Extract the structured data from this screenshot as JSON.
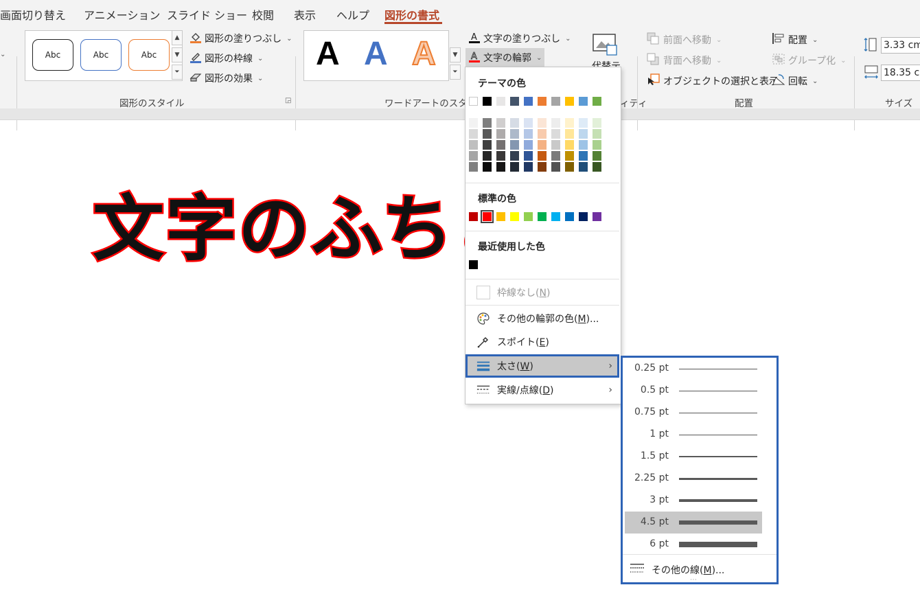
{
  "tabs": [
    {
      "label": "画面切り替え",
      "active": false
    },
    {
      "label": "アニメーション",
      "active": false
    },
    {
      "label": "スライド ショー",
      "active": false
    },
    {
      "label": "校閲",
      "active": false
    },
    {
      "label": "表示",
      "active": false
    },
    {
      "label": "ヘルプ",
      "active": false
    },
    {
      "label": "図形の書式",
      "active": true
    }
  ],
  "ribbon": {
    "shape_styles": {
      "samples": [
        "Abc",
        "Abc",
        "Abc"
      ],
      "sample_border_colors": [
        "#222222",
        "#4472c4",
        "#ed7d31"
      ],
      "fill_label": "図形の塗りつぶし",
      "outline_label": "図形の枠線",
      "effects_label": "図形の効果",
      "group_label": "図形のスタイル"
    },
    "wordart": {
      "samples": [
        "A",
        "A",
        "A"
      ],
      "text_fill_label": "文字の塗りつぶし",
      "text_outline_label": "文字の輪郭",
      "group_label": "ワードアートのスタイル"
    },
    "alt_text_label": "代替テ",
    "partial_label": "ィティ",
    "arrange": {
      "bring_forward_label": "前面へ移動",
      "send_backward_label": "背面へ移動",
      "selection_pane_label": "オブジェクトの選択と表示",
      "align_label": "配置",
      "group_label": "グループ化",
      "rotate_label": "回転",
      "section_label": "配置"
    },
    "size": {
      "height_value": "3.33 cm",
      "width_value": "18.35 cm",
      "group_label": "サイズ"
    }
  },
  "slide": {
    "text": "文字のふちど",
    "fill_color": "#111111",
    "outline_color": "#ff0000"
  },
  "outline_menu": {
    "theme_colors_heading": "テーマの色",
    "theme_colors": [
      "#ffffff",
      "#000000",
      "#e7e6e6",
      "#44546a",
      "#4472c4",
      "#ed7d31",
      "#a5a5a5",
      "#ffc000",
      "#5b9bd5",
      "#70ad47"
    ],
    "theme_shades": [
      [
        "#f2f2f2",
        "#d9d9d9",
        "#bfbfbf",
        "#a6a6a6",
        "#808080"
      ],
      [
        "#7f7f7f",
        "#595959",
        "#404040",
        "#262626",
        "#0d0d0d"
      ],
      [
        "#d0cece",
        "#aeabab",
        "#757171",
        "#3a3838",
        "#171616"
      ],
      [
        "#d6dce5",
        "#adb9ca",
        "#8497b0",
        "#333f50",
        "#222a35"
      ],
      [
        "#dae3f3",
        "#b4c7e7",
        "#8faadc",
        "#2f5597",
        "#203864"
      ],
      [
        "#fbe5d6",
        "#f8cbad",
        "#f4b183",
        "#c55a11",
        "#843c0c"
      ],
      [
        "#ededed",
        "#dbdbdb",
        "#c9c9c9",
        "#7b7b7b",
        "#525252"
      ],
      [
        "#fff2cc",
        "#ffe699",
        "#ffd966",
        "#bf9000",
        "#7f6000"
      ],
      [
        "#deebf7",
        "#bdd7ee",
        "#9dc3e6",
        "#2e75b6",
        "#1f4e79"
      ],
      [
        "#e2f0d9",
        "#c5e0b4",
        "#a9d18e",
        "#548235",
        "#385723"
      ]
    ],
    "standard_colors_heading": "標準の色",
    "standard_colors": [
      "#c00000",
      "#ff0000",
      "#ffc000",
      "#ffff00",
      "#92d050",
      "#00b050",
      "#00b0f0",
      "#0070c0",
      "#002060",
      "#7030a0"
    ],
    "recent_colors_heading": "最近使用した色",
    "recent_colors": [
      "#000000"
    ],
    "no_outline_label": "枠線なし(",
    "no_outline_key": "N",
    "more_colors_label": "その他の輪郭の色(",
    "more_colors_key": "M",
    "more_colors_suffix": ")...",
    "eyedropper_label": "スポイト(",
    "eyedropper_key": "E",
    "weight_label": "太さ(",
    "weight_key": "W",
    "dashes_label": "実線/点線(",
    "dashes_key": "D",
    "close_paren": ")"
  },
  "weight_submenu": {
    "options": [
      {
        "label": "0.25 pt",
        "weight": 0.25
      },
      {
        "label": "0.5 pt",
        "weight": 0.5
      },
      {
        "label": "0.75 pt",
        "weight": 0.75
      },
      {
        "label": "1 pt",
        "weight": 1
      },
      {
        "label": "1.5 pt",
        "weight": 1.5
      },
      {
        "label": "2.25 pt",
        "weight": 2.25
      },
      {
        "label": "3 pt",
        "weight": 3
      },
      {
        "label": "4.5 pt",
        "weight": 4.5
      },
      {
        "label": "6 pt",
        "weight": 6
      }
    ],
    "selected_index": 7,
    "more_lines_label": "その他の線(",
    "more_lines_key": "M",
    "more_lines_suffix": ")..."
  }
}
